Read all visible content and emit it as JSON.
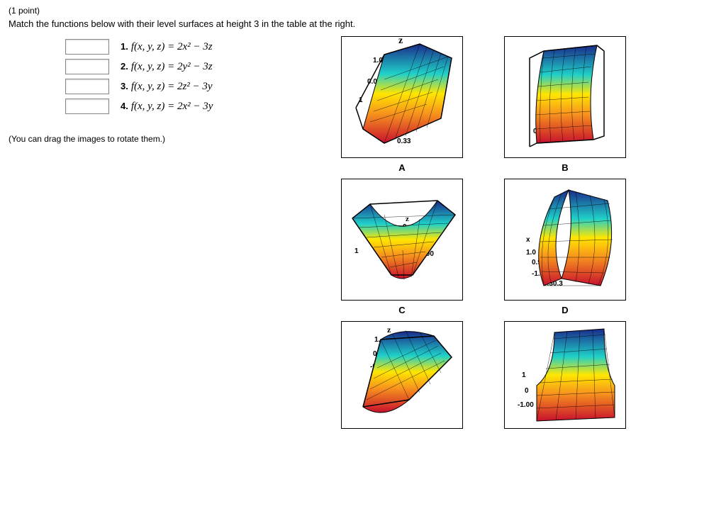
{
  "points": "(1 point)",
  "prompt": "Match the functions below with their level surfaces at height 3 in the table at the right.",
  "functions": [
    {
      "num": "1.",
      "expr": "f(x, y, z) = 2x² − 3z"
    },
    {
      "num": "2.",
      "expr": "f(x, y, z) = 2y² − 3z"
    },
    {
      "num": "3.",
      "expr": "f(x, y, z) = 2z² − 3y"
    },
    {
      "num": "4.",
      "expr": "f(x, y, z) = 2x² − 3y"
    }
  ],
  "hint": "(You can drag the images to rotate them.)",
  "plots": [
    {
      "label": "A",
      "z_label": "z",
      "ticks": [
        "1.0",
        "0.0",
        "1",
        "0.33"
      ]
    },
    {
      "label": "B",
      "z_label": "",
      "ticks": [
        "0"
      ]
    },
    {
      "label": "C",
      "z_label": "z",
      "ticks": [
        "0",
        "1",
        ".00"
      ]
    },
    {
      "label": "D",
      "z_label": "",
      "ticks": [
        "x",
        "1.0",
        "0.9",
        "-1.00",
        "0.30.3"
      ]
    },
    {
      "label": "",
      "z_label": "z",
      "ticks": [
        "1.",
        "0.",
        "-0."
      ]
    },
    {
      "label": "",
      "z_label": "",
      "ticks": [
        "1",
        "0",
        "-1.00"
      ]
    }
  ]
}
